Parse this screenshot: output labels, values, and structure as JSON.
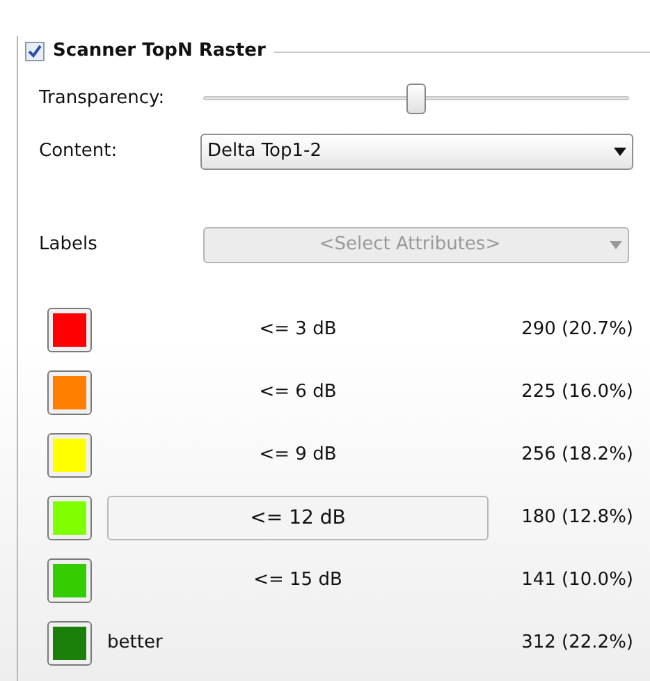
{
  "group": {
    "title": "Scanner TopN Raster",
    "checked": true
  },
  "transparency": {
    "label": "Transparency:",
    "level": 0.5
  },
  "content": {
    "label": "Content:",
    "value": "Delta Top1-2"
  },
  "labels": {
    "label": "Labels",
    "placeholder": "<Select Attributes>",
    "disabled": true
  },
  "legend": [
    {
      "kind": "range",
      "color": "#ff0000",
      "label": "<= 3 dB",
      "count": "290 (20.7%)",
      "selected": false
    },
    {
      "kind": "range",
      "color": "#ff8000",
      "label": "<= 6 dB",
      "count": "225 (16.0%)",
      "selected": false
    },
    {
      "kind": "range",
      "color": "#ffff00",
      "label": "<= 9 dB",
      "count": "256 (18.2%)",
      "selected": false
    },
    {
      "kind": "range",
      "color": "#80ff00",
      "label": "<= 12 dB",
      "count": "180 (12.8%)",
      "selected": true
    },
    {
      "kind": "range",
      "color": "#33cc00",
      "label": "<= 15 dB",
      "count": "141 (10.0%)",
      "selected": false
    },
    {
      "kind": "rest",
      "color": "#1a800a",
      "label": "better",
      "count": "312 (22.2%)",
      "selected": false
    }
  ]
}
